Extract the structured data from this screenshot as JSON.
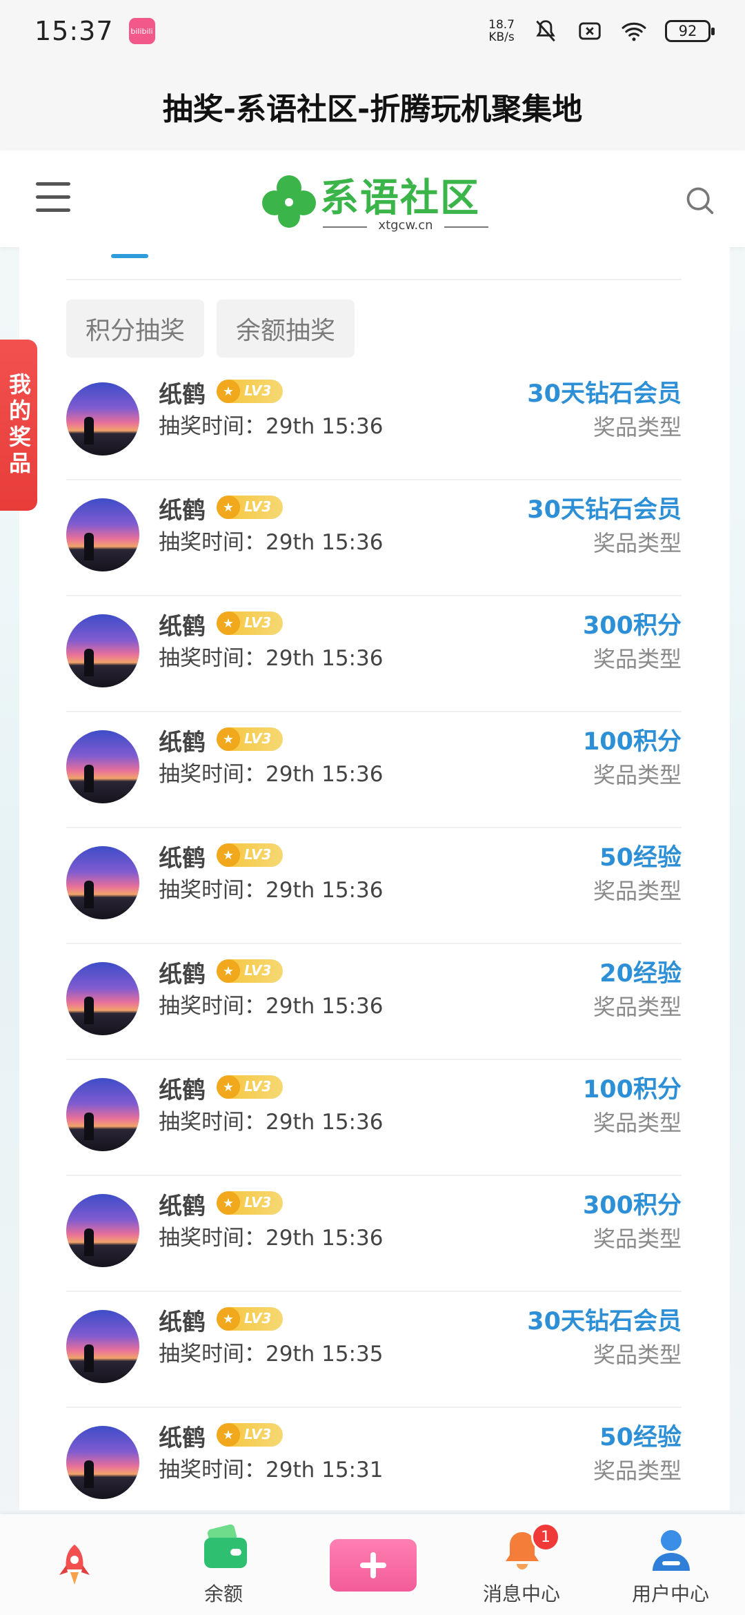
{
  "status_bar": {
    "time": "15:37",
    "app_badge": "bilibili",
    "net_speed_value": "18.7",
    "net_speed_unit": "KB/s",
    "battery": "92"
  },
  "page_title": "抽奖-系语社区-折腾玩机聚集地",
  "header": {
    "logo_text": "系语社区",
    "logo_sub": "xtgcw.cn"
  },
  "chips": [
    "积分抽奖",
    "余额抽奖"
  ],
  "side_tab": "我的奖品",
  "records": [
    {
      "name": "纸鹤",
      "level": "LV3",
      "time": "抽奖时间：29th 15:36",
      "prize": "30天钻石会员",
      "type": "奖品类型"
    },
    {
      "name": "纸鹤",
      "level": "LV3",
      "time": "抽奖时间：29th 15:36",
      "prize": "30天钻石会员",
      "type": "奖品类型"
    },
    {
      "name": "纸鹤",
      "level": "LV3",
      "time": "抽奖时间：29th 15:36",
      "prize": "300积分",
      "type": "奖品类型"
    },
    {
      "name": "纸鹤",
      "level": "LV3",
      "time": "抽奖时间：29th 15:36",
      "prize": "100积分",
      "type": "奖品类型"
    },
    {
      "name": "纸鹤",
      "level": "LV3",
      "time": "抽奖时间：29th 15:36",
      "prize": "50经验",
      "type": "奖品类型"
    },
    {
      "name": "纸鹤",
      "level": "LV3",
      "time": "抽奖时间：29th 15:36",
      "prize": "20经验",
      "type": "奖品类型"
    },
    {
      "name": "纸鹤",
      "level": "LV3",
      "time": "抽奖时间：29th 15:36",
      "prize": "100积分",
      "type": "奖品类型"
    },
    {
      "name": "纸鹤",
      "level": "LV3",
      "time": "抽奖时间：29th 15:36",
      "prize": "300积分",
      "type": "奖品类型"
    },
    {
      "name": "纸鹤",
      "level": "LV3",
      "time": "抽奖时间：29th 15:35",
      "prize": "30天钻石会员",
      "type": "奖品类型"
    },
    {
      "name": "纸鹤",
      "level": "LV3",
      "time": "抽奖时间：29th 15:31",
      "prize": "50经验",
      "type": "奖品类型"
    }
  ],
  "bottom_nav": {
    "balance": "余额",
    "messages": "消息中心",
    "messages_badge": "1",
    "user": "用户中心"
  }
}
